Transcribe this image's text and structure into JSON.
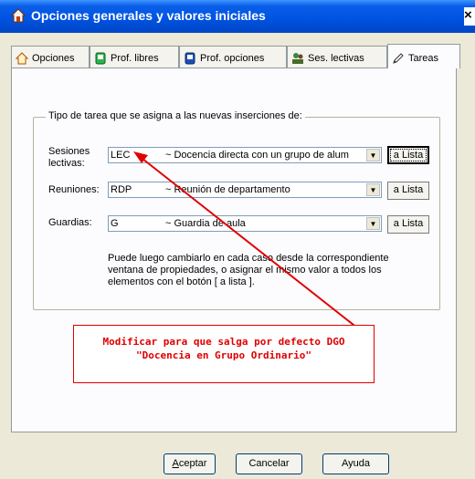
{
  "window": {
    "title": "Opciones generales y valores iniciales",
    "close_glyph": "×"
  },
  "tabs": [
    {
      "label": "Opciones",
      "icon": "house-icon"
    },
    {
      "label": "Prof. libres",
      "icon": "clock-green-icon"
    },
    {
      "label": "Prof. opciones",
      "icon": "clock-blue-icon"
    },
    {
      "label": "Ses. lectivas",
      "icon": "people-icon"
    },
    {
      "label": "Tareas",
      "icon": "pencil-icon",
      "active": true
    }
  ],
  "group": {
    "label": "Tipo de tarea que se asigna a las nuevas inserciones de:"
  },
  "rows": [
    {
      "label": "Sesiones lectivas:",
      "code": "LEC",
      "desc": "~ Docencia directa con un grupo de alum",
      "button": "a Lista"
    },
    {
      "label": "Reuniones:",
      "code": "RDP",
      "desc": "~ Reunión de departamento",
      "button": "a Lista"
    },
    {
      "label": "Guardias:",
      "code": "G",
      "desc": "~ Guardia de aula",
      "button": "a Lista"
    }
  ],
  "info_text": "Puede luego cambiarlo en cada caso desde la correspondiente ventana de propiedades, o asignar el mismo valor a todos los elementos con el botón [ a lista ].",
  "annotation": {
    "line1": "Modificar para que salga por defecto DGO",
    "line2": "\"Docencia en Grupo Ordinario\"",
    "color": "#e00000"
  },
  "buttons": {
    "accept": "Aceptar",
    "cancel": "Cancelar",
    "help": "Ayuda"
  }
}
